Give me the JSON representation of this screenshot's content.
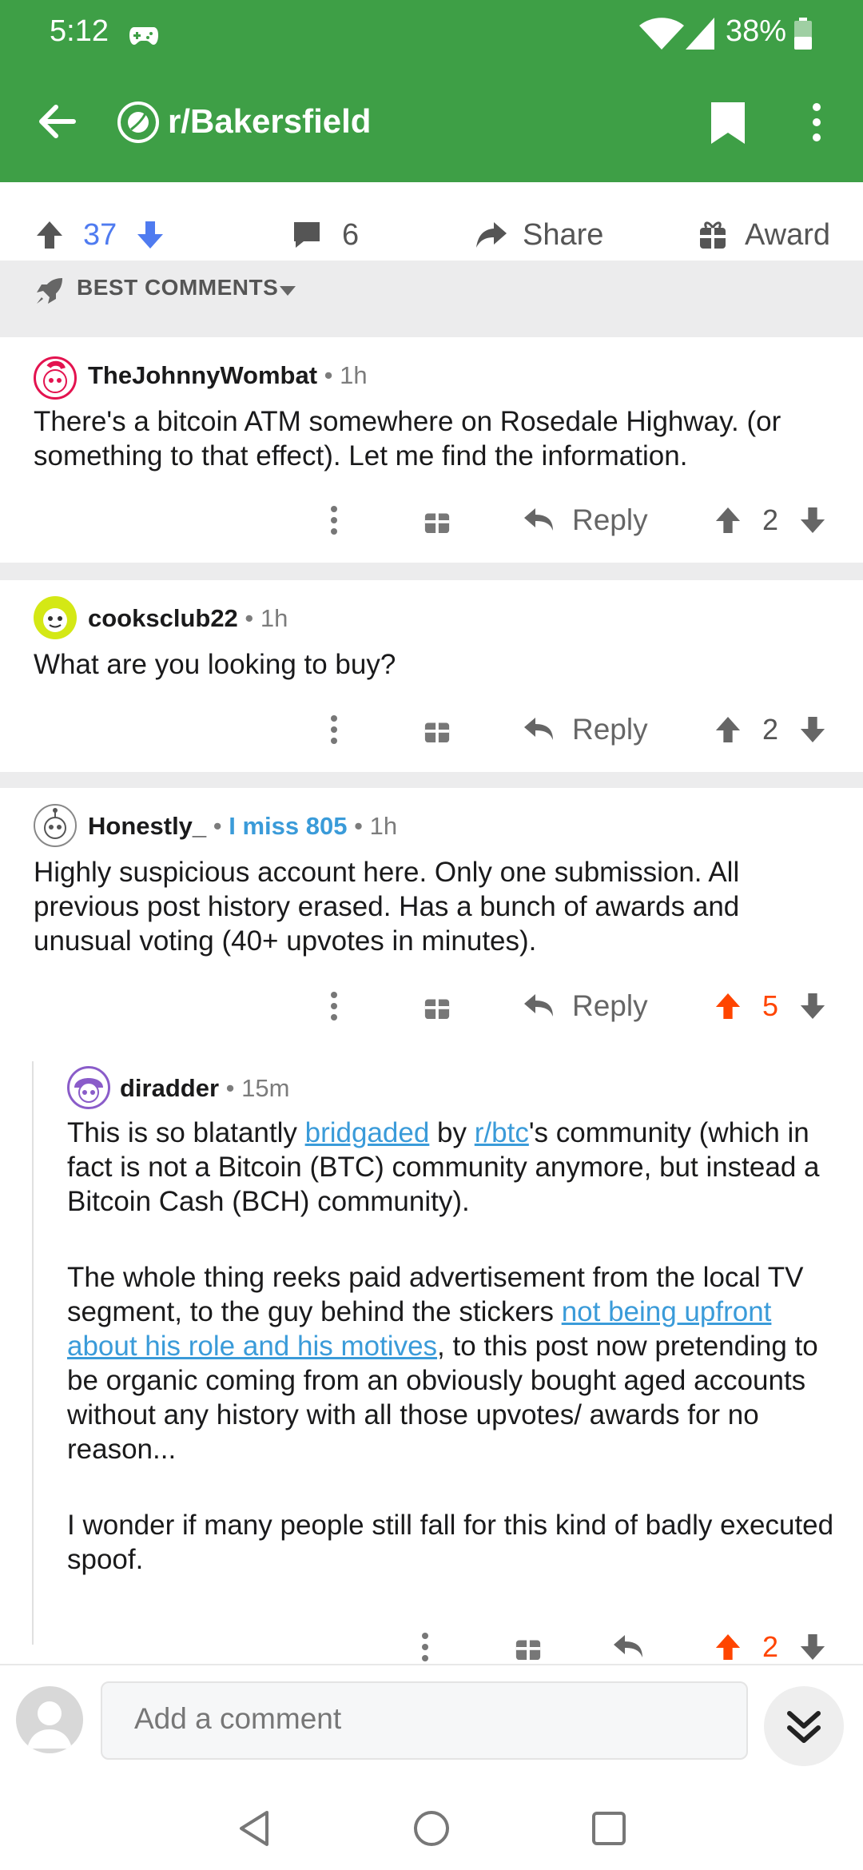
{
  "status_bar": {
    "time": "5:12",
    "battery": "38%"
  },
  "header": {
    "subreddit": "r/Bakersfield"
  },
  "post_actions": {
    "score": "37",
    "comments": "6",
    "share": "Share",
    "award": "Award"
  },
  "sort": {
    "label": "BEST COMMENTS"
  },
  "comments": [
    {
      "user": "TheJohnnyWombat",
      "age": "1h",
      "text": "There's a bitcoin ATM somewhere on Rosedale Highway. (or something to that effect). Let me find the information.",
      "reply": "Reply",
      "score": "2"
    },
    {
      "user": "cooksclub22",
      "age": "1h",
      "text": "What are you looking to buy?",
      "reply": "Reply",
      "score": "2"
    },
    {
      "user": "Honestly_",
      "flair": "I miss 805",
      "age": "1h",
      "text": "Highly suspicious account here. Only one submission. All previous post history erased. Has a bunch of awards and unusual voting (40+ upvotes in minutes).",
      "reply": "Reply",
      "score": "5"
    },
    {
      "user": "diradder",
      "age": "15m",
      "p1": {
        "t1": "This is so blatantly ",
        "link1": "bridgaded",
        "t2": " by ",
        "link2": "r/btc",
        "t3": "'s community (which in fact is not a Bitcoin (BTC) community anymore, but instead a Bitcoin Cash (BCH) community)."
      },
      "p2": {
        "t1": "The whole thing reeks paid advertisement from the local TV segment, to the guy behind the stickers ",
        "link1": "not being upfront about his role and his motives",
        "t2": ", to this post now pretending to be organic coming from an obviously bought aged accounts without any history with all those upvotes/ awards for no reason..."
      },
      "p3": "I wonder if many people still fall for this kind of badly executed spoof.",
      "score": "2"
    }
  ],
  "composer": {
    "placeholder": "Add a comment"
  },
  "colors": {
    "header": "#3e9f46",
    "upvote_active": "#ff4500",
    "upvote_blue": "#4f7bf0",
    "link": "#3a9bd9"
  }
}
